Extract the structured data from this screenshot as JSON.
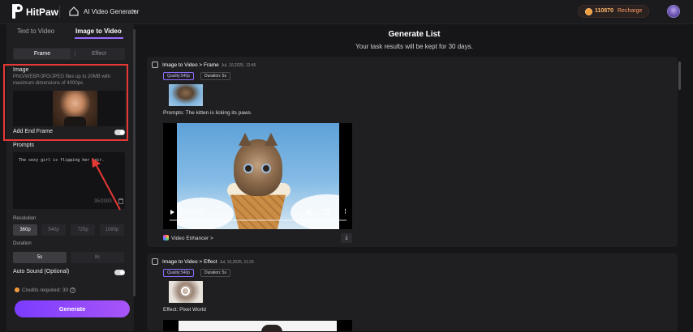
{
  "header": {
    "brand": "HitPaw",
    "tool_name": "AI Video Generator",
    "credits": "110870",
    "recharge": "Recharge"
  },
  "left": {
    "tabs": [
      "Text to Video",
      "Image to Video"
    ],
    "segment": [
      "Frame",
      "Effect"
    ],
    "image_label": "Image",
    "image_hint": "PNG/WEBP/JPG/JPEG files up to 20MB with maximum dimensions of 4000px.",
    "add_end_frame": "Add End Frame",
    "prompts_label": "Prompts",
    "prompt_value": "The sexy girl is flipping her hair.",
    "counter": "35/2000",
    "resolution_label": "Resolution",
    "resolutions": [
      "360p",
      "540p",
      "720p",
      "1080p"
    ],
    "duration_label": "Duration",
    "durations": [
      "5s",
      "8s"
    ],
    "auto_sound": "Auto Sound (Optional)",
    "credits_required": "Credits required: 30",
    "generate": "Generate"
  },
  "main": {
    "title": "Generate List",
    "subtitle": "Your task results will be kept for 30 days.",
    "cards": [
      {
        "title": "Image to Video > Frame",
        "date": "Jul, 10,2025, 12:45",
        "quality": "Quality:540p",
        "duration": "Duration: 5s",
        "prompt": "Prompts:  The kitten is licking its paws.",
        "time": "0:00 / 0:05",
        "enhancer": "Video Enhancer >"
      },
      {
        "title": "Image to Video > Effect",
        "date": "Jul, 10,2025, 11:23",
        "quality": "Quality:540p",
        "duration": "Duration: 5s",
        "effect": "Effect: Pixel World"
      }
    ]
  }
}
